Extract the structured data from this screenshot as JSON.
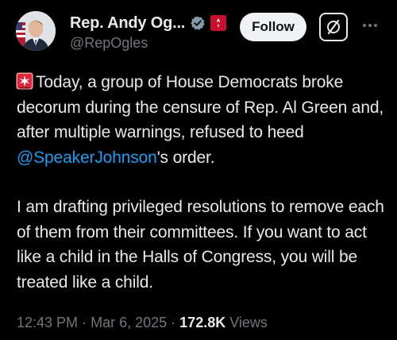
{
  "author": {
    "display_name": "Rep. Andy Og...",
    "handle": "@RepOgles",
    "verified_icon": "verified-badge-icon",
    "affiliate_icon": "house-seal-icon"
  },
  "actions": {
    "follow_label": "Follow",
    "grok_icon": "grok-icon",
    "more_icon": "more-icon"
  },
  "tweet": {
    "emoji": "siren-icon",
    "p1_before_mention": "Today, a group of House Democrats broke decorum during the censure of Rep. Al Green and, after multiple warnings, refused to heed ",
    "mention": "@SpeakerJohnson",
    "p1_after_mention": "'s order.",
    "p2": "I am drafting privileged resolutions to remove each of them from their committees. If you want to act like a child in the Halls of Congress, you will be treated like a child."
  },
  "meta": {
    "time": "12:43 PM",
    "separator": "·",
    "date": "Mar 6, 2025",
    "views_count": "172.8K",
    "views_label": "Views"
  },
  "colors": {
    "background": "#000000",
    "text": "#e7e9ea",
    "secondary": "#71767b",
    "link": "#1d9bf0",
    "follow_bg": "#eff3f4"
  }
}
